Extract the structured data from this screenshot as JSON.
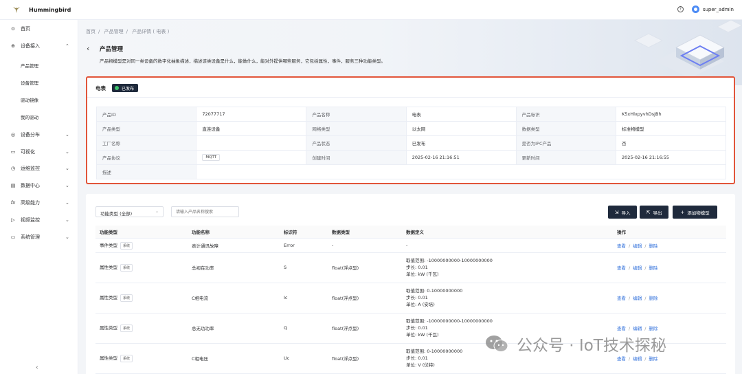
{
  "app": {
    "name": "Hummingbird"
  },
  "topbar": {
    "help_icon": "question-circle-icon",
    "username": "super_admin"
  },
  "sidebar": {
    "items": [
      {
        "label": "首页",
        "icon": "home-icon"
      },
      {
        "label": "设备接入",
        "icon": "globe-icon",
        "expanded": true,
        "children": [
          "产品管理",
          "设备管理",
          "驱动镜像",
          "我的驱动"
        ]
      },
      {
        "label": "设备分布",
        "icon": "location-icon"
      },
      {
        "label": "可视化",
        "icon": "monitor-icon"
      },
      {
        "label": "运维监控",
        "icon": "clock-icon"
      },
      {
        "label": "数据中心",
        "icon": "data-icon"
      },
      {
        "label": "高级能力",
        "icon": "fx-icon"
      },
      {
        "label": "视频监控",
        "icon": "video-icon"
      },
      {
        "label": "系统管理",
        "icon": "desktop-icon"
      }
    ],
    "collapse_icon": "chevron-left-icon"
  },
  "breadcrumb": [
    "首页",
    "产品管理",
    "产品详情 ( 电表 )"
  ],
  "header": {
    "title": "产品管理",
    "description": "产品物模型是对同一类设备的数字化抽象描述，描述该类设备是什么，能做什么，能对外提供哪些服务，它包括属性，事件，服务三种功能类型。"
  },
  "product": {
    "name": "电表",
    "status_badge": "已发布",
    "fields": {
      "id_label": "产品ID",
      "id_value": "72077717",
      "name_label": "产品名称",
      "name_value": "电表",
      "key_label": "产品标识",
      "key_value": "K5xHlxpyvhDsJBh",
      "type_label": "产品类型",
      "type_value": "直连设备",
      "net_label": "网络类型",
      "net_value": "以太网",
      "data_label": "数据类型",
      "data_value": "标准物模型",
      "factory_label": "工厂名称",
      "factory_value": "",
      "state_label": "产品状态",
      "state_value": "已发布",
      "ipc_label": "是否为IPC产品",
      "ipc_value": "否",
      "proto_label": "产品协议",
      "proto_value": "MQTT",
      "created_label": "创建时间",
      "created_value": "2025-02-16 21:16:51",
      "updated_label": "更新时间",
      "updated_value": "2025-02-16 21:16:55",
      "desc_label": "描述",
      "desc_value": ""
    }
  },
  "toolbar": {
    "filter_value": "功能类型 (全部)",
    "search_placeholder": "请输入产品名称搜索",
    "import_label": "导入",
    "export_label": "导出",
    "add_label": "添加物模型"
  },
  "table": {
    "headers": [
      "功能类型",
      "功能名称",
      "标识符",
      "数据类型",
      "数据定义",
      "操作"
    ],
    "sys_tag": "系统",
    "actions": [
      "查看",
      "编辑",
      "删除"
    ],
    "rows": [
      {
        "type": "事件类型",
        "name": "表计通讯故障",
        "id": "Error",
        "dtype": "-",
        "def": [
          "-"
        ]
      },
      {
        "type": "属性类型",
        "name": "总视在功率",
        "id": "S",
        "dtype": "float(浮点型)",
        "def": [
          "取值范围: -10000000000-10000000000",
          "步长: 0.01",
          "单位: kW (千瓦)"
        ]
      },
      {
        "type": "属性类型",
        "name": "C相电流",
        "id": "Ic",
        "dtype": "float(浮点型)",
        "def": [
          "取值范围: 0-10000000000",
          "步长: 0.01",
          "单位: A (安培)"
        ]
      },
      {
        "type": "属性类型",
        "name": "总无功功率",
        "id": "Q",
        "dtype": "float(浮点型)",
        "def": [
          "取值范围: -10000000000-10000000000",
          "步长: 0.01",
          "单位: kW (千瓦)"
        ]
      },
      {
        "type": "属性类型",
        "name": "C相电压",
        "id": "Uc",
        "dtype": "float(浮点型)",
        "def": [
          "取值范围: 0-10000000000",
          "步长: 0.01",
          "单位: V (伏特)"
        ]
      }
    ]
  },
  "watermark": {
    "text": "公众号 · IoT技术探秘",
    "icon": "wechat-icon"
  }
}
